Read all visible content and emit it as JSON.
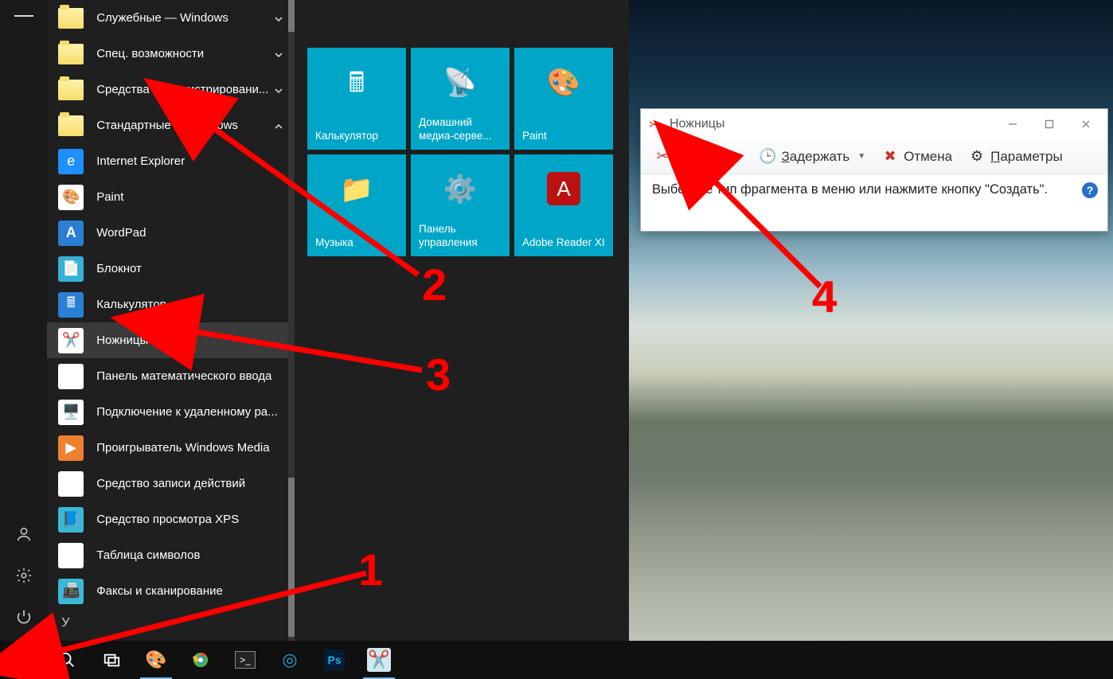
{
  "start_menu": {
    "folders": [
      {
        "label": "Служебные — Windows",
        "chevron": "down"
      },
      {
        "label": "Спец. возможности",
        "chevron": "down"
      },
      {
        "label": "Средства администрировани...",
        "chevron": "down"
      },
      {
        "label": "Стандартные — Windows",
        "chevron": "up"
      }
    ],
    "apps": [
      {
        "label": "Internet Explorer",
        "icon": "ie"
      },
      {
        "label": "Paint",
        "icon": "paint"
      },
      {
        "label": "WordPad",
        "icon": "wordpad"
      },
      {
        "label": "Блокнот",
        "icon": "notepad"
      },
      {
        "label": "Калькулятор",
        "icon": "calc"
      },
      {
        "label": "Ножницы",
        "icon": "snip",
        "hover": true
      },
      {
        "label": "Панель математического ввода",
        "icon": "math"
      },
      {
        "label": "Подключение к удаленному ра...",
        "icon": "rdp"
      },
      {
        "label": "Проигрыватель Windows Media",
        "icon": "wmp"
      },
      {
        "label": "Средство записи действий",
        "icon": "record"
      },
      {
        "label": "Средство просмотра XPS",
        "icon": "xps"
      },
      {
        "label": "Таблица символов",
        "icon": "charmap"
      },
      {
        "label": "Факсы и сканирование",
        "icon": "fax"
      }
    ],
    "letter_header": "У"
  },
  "tiles": [
    {
      "label": "Калькулятор",
      "icon": "calc"
    },
    {
      "label": "Домашний медиа-серве...",
      "icon": "media"
    },
    {
      "label": "Paint",
      "icon": "paint"
    },
    {
      "label": "Музыка",
      "icon": "music"
    },
    {
      "label": "Панель управления",
      "icon": "control"
    },
    {
      "label": "Adobe Reader XI",
      "icon": "adobe"
    }
  ],
  "snipping": {
    "title": "Ножницы",
    "toolbar": {
      "create": "Создать",
      "delay": "Задержать",
      "cancel": "Отмена",
      "options": "Параметры"
    },
    "body": "Выберите тип фрагмента в меню или нажмите кнопку \"Создать\"."
  },
  "taskbar": {
    "items": [
      "start",
      "search",
      "taskview",
      "paint",
      "chrome",
      "cmd",
      "teamviewer",
      "ps",
      "snip"
    ]
  },
  "annotations": {
    "n1": "1",
    "n2": "2",
    "n3": "3",
    "n4": "4"
  }
}
